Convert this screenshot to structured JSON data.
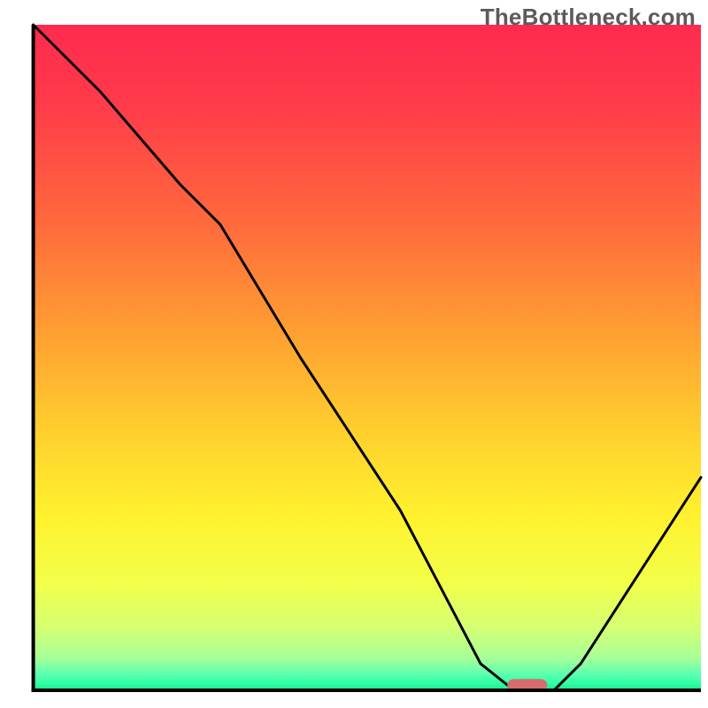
{
  "watermark": "TheBottleneck.com",
  "chart_data": {
    "type": "line",
    "title": "",
    "xlabel": "",
    "ylabel": "",
    "categories": [],
    "x_range": [
      0,
      100
    ],
    "y_range": [
      0,
      100
    ],
    "series": [
      {
        "name": "bottleneck-curve",
        "x": [
          0,
          10,
          22,
          28,
          40,
          55,
          67,
          72,
          78,
          82,
          100
        ],
        "y": [
          100,
          90,
          76,
          70,
          50,
          27,
          4,
          0,
          0,
          4,
          32
        ]
      }
    ],
    "marker": {
      "name": "target-marker",
      "x": 74,
      "y": 0.8,
      "width_pct": 6,
      "height_pct": 1.8,
      "color": "#d86b6f"
    },
    "gradient_stops": [
      {
        "offset": 0.0,
        "color": "#ff2a4e"
      },
      {
        "offset": 0.12,
        "color": "#ff3b4a"
      },
      {
        "offset": 0.3,
        "color": "#ff6a3c"
      },
      {
        "offset": 0.48,
        "color": "#ffa531"
      },
      {
        "offset": 0.62,
        "color": "#ffd22e"
      },
      {
        "offset": 0.74,
        "color": "#fff22e"
      },
      {
        "offset": 0.84,
        "color": "#f2ff4a"
      },
      {
        "offset": 0.905,
        "color": "#d6ff72"
      },
      {
        "offset": 0.952,
        "color": "#a6ff99"
      },
      {
        "offset": 0.975,
        "color": "#5fffb0"
      },
      {
        "offset": 0.99,
        "color": "#2effa3"
      },
      {
        "offset": 1.0,
        "color": "#17e58e"
      }
    ],
    "axes": {
      "left": {
        "x": 4.7,
        "y1": 3.5,
        "y2": 97.5
      },
      "bottom": {
        "y": 97.5,
        "x1": 4.7,
        "x2": 99.0
      }
    }
  }
}
